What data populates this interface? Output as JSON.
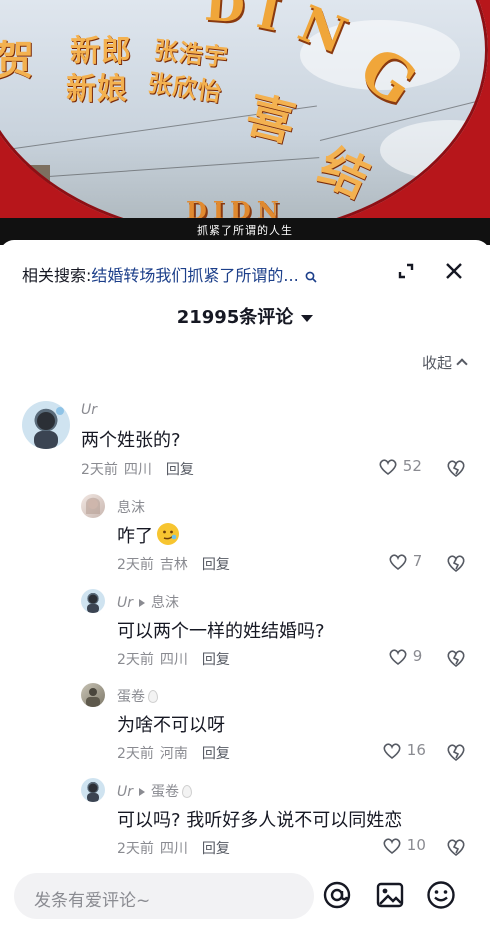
{
  "video": {
    "arch_letters": [
      "D",
      "I",
      "N",
      "G"
    ],
    "arch_lower_letters": "DIDN",
    "groom_label": "新郎",
    "groom_name": "张浩宇",
    "bride_label": "新娘",
    "bride_name": "张欣怡",
    "left_char": "贺",
    "big_chars": [
      "喜",
      "结"
    ],
    "subtitle": "抓紧了所谓的人生"
  },
  "header": {
    "related_label": "相关搜索:",
    "related_query": "结婚转场我们抓紧了所谓的...",
    "comment_count": "21995条评论",
    "collapse_label": "收起"
  },
  "comments": [
    {
      "user": "Ur",
      "text": "两个姓张的?",
      "time": "2天前",
      "location": "四川",
      "reply_label": "回复",
      "likes": "52"
    },
    {
      "user": "息沫",
      "text": "咋了",
      "time": "2天前",
      "location": "吉林",
      "reply_label": "回复",
      "likes": "7"
    },
    {
      "user": "Ur",
      "reply_to": "息沫",
      "text": "可以两个一样的姓结婚吗?",
      "time": "2天前",
      "location": "四川",
      "reply_label": "回复",
      "likes": "9"
    },
    {
      "user": "蛋卷",
      "text": "为啥不可以呀",
      "time": "2天前",
      "location": "河南",
      "reply_label": "回复",
      "likes": "16"
    },
    {
      "user": "Ur",
      "reply_to": "蛋卷",
      "text": "可以吗? 我听好多人说不可以同姓恋",
      "time": "2天前",
      "location": "四川",
      "reply_label": "回复",
      "likes": "10"
    }
  ],
  "input": {
    "placeholder": "发条有爱评论~"
  },
  "colors": {
    "arch_red": "#b7161b",
    "gold_text": "#f0a63a",
    "query_blue": "#1c3f8a",
    "secondary_text": "#8a8b91"
  },
  "icons": [
    "search-icon",
    "expand-icon",
    "close-icon",
    "caret-down-icon",
    "chevron-up-icon",
    "heart-icon",
    "dislike-icon",
    "at-icon",
    "image-icon",
    "smile-icon"
  ]
}
